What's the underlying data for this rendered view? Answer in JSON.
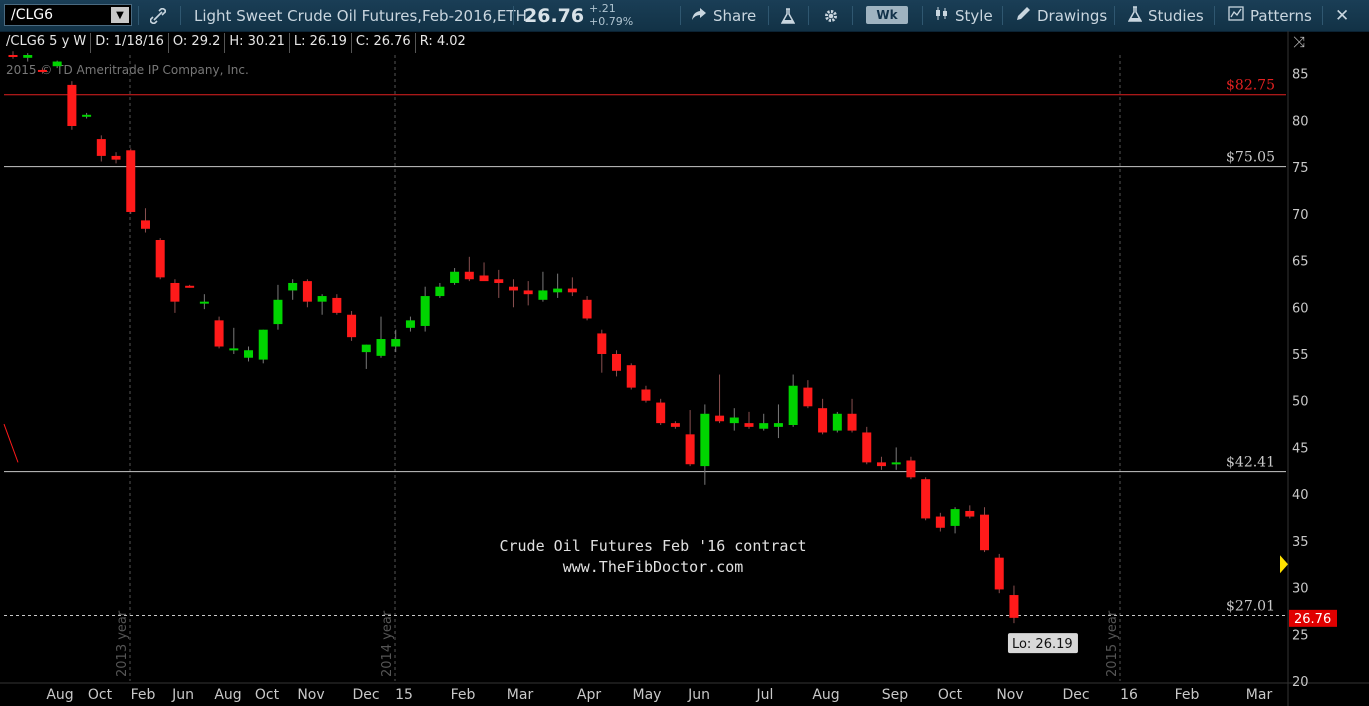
{
  "toolbar": {
    "symbol": "/CLG6",
    "description": "Light Sweet Crude Oil Futures,Feb-2016,ETH",
    "last_price": "26.76",
    "change": "+.21",
    "change_pct": "+0.79%",
    "share_label": "Share",
    "aggregation_label": "Wk",
    "style_label": "Style",
    "drawings_label": "Drawings",
    "studies_label": "Studies",
    "patterns_label": "Patterns"
  },
  "ohlc": {
    "symbol_period": "/CLG6 5 y W",
    "date": "D: 1/18/16",
    "open": "O: 29.2",
    "high": "H: 30.21",
    "low": "L: 26.19",
    "close": "C: 26.76",
    "range": "R: 4.02"
  },
  "copyright": "2015 © TD Ameritrade IP Company, Inc.",
  "colors": {
    "up": "#00d400",
    "down": "#ff1a1a",
    "price_badge": "#e00000",
    "accent_yellow": "#ffe100",
    "toolbar_bg": "#153a52"
  },
  "chart_data": {
    "type": "candlestick",
    "annotation_lines": [
      "Crude Oil Futures Feb '16 contract",
      "www.TheFibDoctor.com"
    ],
    "horizontal_levels": [
      {
        "label": "$82.75",
        "value": 82.75,
        "color": "#e02020"
      },
      {
        "label": "$75.05",
        "value": 75.05,
        "color": "#c8c8c8"
      },
      {
        "label": "$42.41",
        "value": 42.41,
        "color": "#c8c8c8"
      },
      {
        "label": "$27.01",
        "value": 27.01,
        "color": "#c8c8c8",
        "dashed": true
      }
    ],
    "price_badge": "26.76",
    "low_label": "Lo: 26.19",
    "ylim": [
      20,
      87
    ],
    "y_ticks": [
      20,
      25,
      30,
      35,
      40,
      45,
      50,
      55,
      60,
      65,
      70,
      75,
      80,
      85
    ],
    "x_ticks": [
      "Aug",
      "Oct",
      "Feb",
      "Jun",
      "Aug",
      "Oct",
      "Nov",
      "Dec",
      "15",
      "Feb",
      "Mar",
      "Apr",
      "May",
      "Jun",
      "Jul",
      "Aug",
      "Sep",
      "Oct",
      "Nov",
      "Dec",
      "16",
      "Feb",
      "Mar"
    ],
    "year_labels": [
      "2013 year",
      "2014 year",
      "2015 year"
    ],
    "candles": [
      {
        "o": 87.0,
        "h": 87.4,
        "l": 86.6,
        "c": 86.8
      },
      {
        "o": 86.7,
        "h": 87.2,
        "l": 86.3,
        "c": 87.0
      },
      {
        "o": 85.4,
        "h": 85.6,
        "l": 85.0,
        "c": 85.2
      },
      {
        "o": 85.8,
        "h": 86.4,
        "l": 85.6,
        "c": 86.3
      },
      {
        "o": 83.8,
        "h": 84.2,
        "l": 79.0,
        "c": 79.4
      },
      {
        "o": 80.4,
        "h": 80.8,
        "l": 80.2,
        "c": 80.6
      },
      {
        "o": 78.0,
        "h": 78.4,
        "l": 75.6,
        "c": 76.2
      },
      {
        "o": 76.2,
        "h": 76.6,
        "l": 75.4,
        "c": 75.8
      },
      {
        "o": 76.8,
        "h": 77.0,
        "l": 70.0,
        "c": 70.2
      },
      {
        "o": 69.3,
        "h": 70.6,
        "l": 68.0,
        "c": 68.4
      },
      {
        "o": 67.2,
        "h": 67.4,
        "l": 63.0,
        "c": 63.2
      },
      {
        "o": 62.6,
        "h": 63.0,
        "l": 59.4,
        "c": 60.6
      },
      {
        "o": 62.3,
        "h": 62.4,
        "l": 62.1,
        "c": 62.2
      },
      {
        "o": 60.6,
        "h": 61.4,
        "l": 59.8,
        "c": 60.6
      },
      {
        "o": 58.6,
        "h": 59.0,
        "l": 55.6,
        "c": 55.8
      },
      {
        "o": 55.4,
        "h": 57.8,
        "l": 55.0,
        "c": 55.6
      },
      {
        "o": 54.6,
        "h": 55.8,
        "l": 54.2,
        "c": 55.4
      },
      {
        "o": 54.4,
        "h": 57.6,
        "l": 54.0,
        "c": 57.6
      },
      {
        "o": 58.2,
        "h": 62.4,
        "l": 57.6,
        "c": 60.8
      },
      {
        "o": 61.8,
        "h": 63.0,
        "l": 60.8,
        "c": 62.6
      },
      {
        "o": 62.8,
        "h": 63.0,
        "l": 60.0,
        "c": 60.6
      },
      {
        "o": 60.6,
        "h": 61.4,
        "l": 59.2,
        "c": 61.2
      },
      {
        "o": 61.0,
        "h": 61.4,
        "l": 59.2,
        "c": 59.4
      },
      {
        "o": 59.2,
        "h": 59.6,
        "l": 56.4,
        "c": 56.8
      },
      {
        "o": 55.2,
        "h": 56.0,
        "l": 53.4,
        "c": 56.0
      },
      {
        "o": 54.8,
        "h": 59.0,
        "l": 54.6,
        "c": 56.6
      },
      {
        "o": 55.8,
        "h": 57.6,
        "l": 55.2,
        "c": 56.6
      },
      {
        "o": 57.8,
        "h": 59.0,
        "l": 57.4,
        "c": 58.6
      },
      {
        "o": 58.0,
        "h": 62.2,
        "l": 57.4,
        "c": 61.2
      },
      {
        "o": 61.2,
        "h": 62.6,
        "l": 61.0,
        "c": 62.2
      },
      {
        "o": 62.6,
        "h": 64.2,
        "l": 62.4,
        "c": 63.8
      },
      {
        "o": 63.8,
        "h": 65.4,
        "l": 62.8,
        "c": 63.0
      },
      {
        "o": 63.4,
        "h": 64.8,
        "l": 63.0,
        "c": 62.8
      },
      {
        "o": 63.0,
        "h": 64.0,
        "l": 61.0,
        "c": 62.6
      },
      {
        "o": 62.2,
        "h": 63.0,
        "l": 60.0,
        "c": 61.8
      },
      {
        "o": 61.8,
        "h": 62.8,
        "l": 60.2,
        "c": 61.4
      },
      {
        "o": 60.8,
        "h": 63.8,
        "l": 60.6,
        "c": 61.8
      },
      {
        "o": 61.6,
        "h": 63.6,
        "l": 61.0,
        "c": 62.0
      },
      {
        "o": 62.0,
        "h": 63.2,
        "l": 61.2,
        "c": 61.6
      },
      {
        "o": 60.8,
        "h": 61.2,
        "l": 58.6,
        "c": 58.8
      },
      {
        "o": 57.2,
        "h": 57.6,
        "l": 53.0,
        "c": 55.0
      },
      {
        "o": 55.0,
        "h": 55.4,
        "l": 52.6,
        "c": 53.2
      },
      {
        "o": 53.8,
        "h": 54.0,
        "l": 51.2,
        "c": 51.4
      },
      {
        "o": 51.2,
        "h": 51.6,
        "l": 49.8,
        "c": 50.0
      },
      {
        "o": 49.8,
        "h": 50.2,
        "l": 47.4,
        "c": 47.6
      },
      {
        "o": 47.6,
        "h": 47.8,
        "l": 47.0,
        "c": 47.2
      },
      {
        "o": 46.4,
        "h": 49.0,
        "l": 43.0,
        "c": 43.2
      },
      {
        "o": 43.0,
        "h": 49.6,
        "l": 41.0,
        "c": 48.6
      },
      {
        "o": 48.4,
        "h": 52.8,
        "l": 47.6,
        "c": 47.8
      },
      {
        "o": 47.6,
        "h": 49.2,
        "l": 46.8,
        "c": 48.2
      },
      {
        "o": 47.6,
        "h": 48.8,
        "l": 47.0,
        "c": 47.2
      },
      {
        "o": 47.0,
        "h": 48.6,
        "l": 46.8,
        "c": 47.6
      },
      {
        "o": 47.2,
        "h": 49.6,
        "l": 46.0,
        "c": 47.6
      },
      {
        "o": 47.4,
        "h": 52.8,
        "l": 47.2,
        "c": 51.6
      },
      {
        "o": 51.4,
        "h": 52.2,
        "l": 49.2,
        "c": 49.4
      },
      {
        "o": 49.2,
        "h": 50.2,
        "l": 46.4,
        "c": 46.6
      },
      {
        "o": 46.8,
        "h": 48.8,
        "l": 46.6,
        "c": 48.6
      },
      {
        "o": 48.6,
        "h": 50.2,
        "l": 46.6,
        "c": 46.8
      },
      {
        "o": 46.6,
        "h": 47.2,
        "l": 43.2,
        "c": 43.4
      },
      {
        "o": 43.4,
        "h": 44.0,
        "l": 42.6,
        "c": 43.0
      },
      {
        "o": 43.2,
        "h": 45.0,
        "l": 42.6,
        "c": 43.4
      },
      {
        "o": 43.6,
        "h": 44.0,
        "l": 41.6,
        "c": 41.8
      },
      {
        "o": 41.6,
        "h": 41.8,
        "l": 37.2,
        "c": 37.4
      },
      {
        "o": 37.6,
        "h": 38.0,
        "l": 36.0,
        "c": 36.4
      },
      {
        "o": 36.6,
        "h": 38.6,
        "l": 35.8,
        "c": 38.4
      },
      {
        "o": 38.2,
        "h": 38.8,
        "l": 37.4,
        "c": 37.6
      },
      {
        "o": 37.8,
        "h": 38.6,
        "l": 33.8,
        "c": 34.0
      },
      {
        "o": 33.2,
        "h": 33.6,
        "l": 29.4,
        "c": 29.8
      },
      {
        "o": 29.2,
        "h": 30.21,
        "l": 26.19,
        "c": 26.76
      }
    ]
  }
}
